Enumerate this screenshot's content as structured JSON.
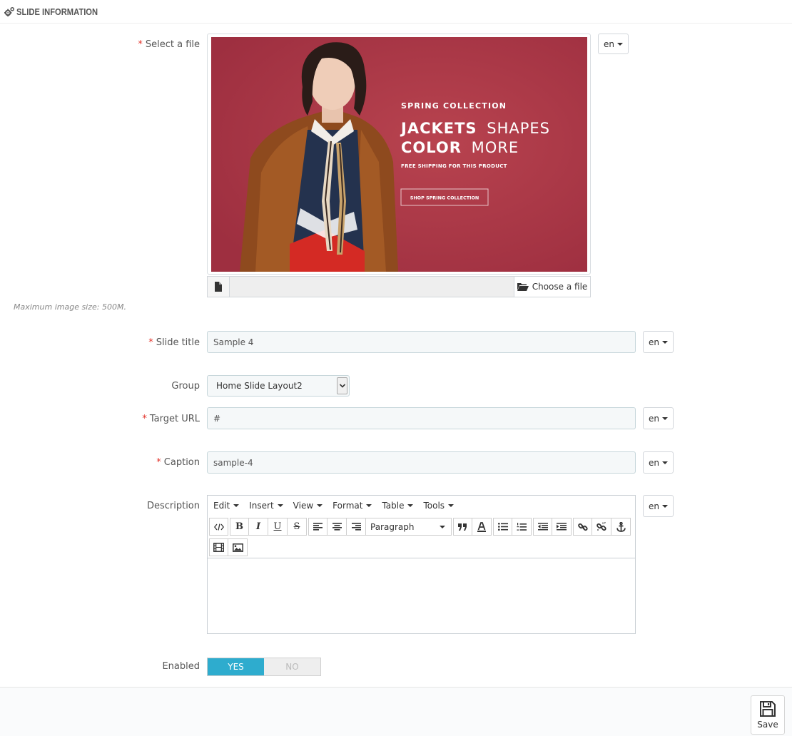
{
  "panel": {
    "title": "SLIDE INFORMATION",
    "icon": "cogs-icon"
  },
  "required_mark": "*",
  "fields": {
    "file": {
      "label": "Select a file",
      "lang": "en",
      "choose_label": "Choose a file",
      "help": "Maximum image size: 500M."
    },
    "slide_title": {
      "label": "Slide title",
      "value": "Sample 4",
      "lang": "en"
    },
    "group": {
      "label": "Group",
      "value": "Home Slide Layout2"
    },
    "target_url": {
      "label": "Target URL",
      "value": "#",
      "lang": "en"
    },
    "caption": {
      "label": "Caption",
      "value": "sample-4",
      "lang": "en"
    },
    "description": {
      "label": "Description",
      "lang": "en",
      "menu": [
        "Edit",
        "Insert",
        "View",
        "Format",
        "Table",
        "Tools"
      ],
      "format_value": "Paragraph"
    },
    "enabled": {
      "label": "Enabled",
      "yes": "YES",
      "no": "NO"
    }
  },
  "slide_image": {
    "eyebrow": "SPRING COLLECTION",
    "headline_bold_1": "JACKETS",
    "headline_light_1": "SHAPES",
    "headline_bold_2": "COLOR",
    "headline_light_2": "MORE",
    "subline": "FREE SHIPPING FOR THIS PRODUCT",
    "button": "SHOP SPRING COLLECTION",
    "background_color": "#b23a4a"
  },
  "footer": {
    "save_label": "Save"
  },
  "colors": {
    "accent": "#2eacce",
    "required": "#e3332a"
  }
}
